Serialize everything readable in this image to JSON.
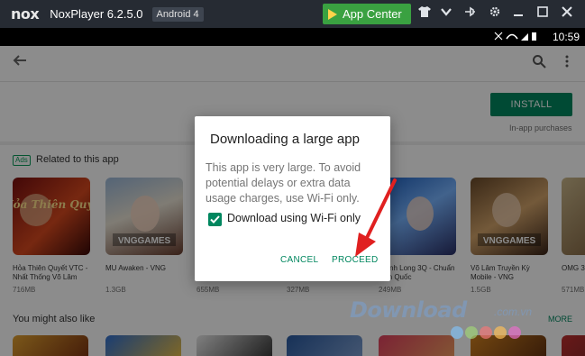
{
  "window": {
    "logo": "nox",
    "title": "NoxPlayer 6.2.5.0",
    "android_badge": "Android 4",
    "app_center_label": "App Center"
  },
  "statusbar": {
    "time": "10:59",
    "icons": "✱ ◥ ◢"
  },
  "store": {
    "install_label": "INSTALL",
    "in_app": "In-app purchases",
    "ads_badge": "Ads",
    "related_title": "Related to this app",
    "also_like_title": "You might also like",
    "more_label": "MORE",
    "apps": [
      {
        "name": "Hỏa Thiên Quyết VTC - Nhất Thống Võ Lâm",
        "size": "716MB"
      },
      {
        "name": "MU Awaken - VNG",
        "size": "1.3GB"
      },
      {
        "name": "",
        "size": "655MB"
      },
      {
        "name": "",
        "size": "327MB"
      },
      {
        "name": "Chinh Long 3Q - Chuẩn Tam Quốc",
        "size": "249MB"
      },
      {
        "name": "Võ Lâm Truyền Kỳ Mobile - VNG",
        "size": "1.5GB"
      },
      {
        "name": "OMG 3Q - Tam Quốc",
        "size": "571MB"
      }
    ],
    "thumb_texts": {
      "t1": "Hỏa Thiên Quyết",
      "t2": "VNGGAMES",
      "t6": "VNGGAMES"
    }
  },
  "dialog": {
    "title": "Downloading a large app",
    "message": "This app is very large. To avoid potential delays or extra data usage charges, use Wi-Fi only.",
    "checkbox_label": "Download using Wi-Fi only",
    "checkbox_checked": true,
    "cancel_label": "CANCEL",
    "proceed_label": "PROCEED"
  },
  "watermark": {
    "main": "Download",
    "sub": ".com.vn"
  },
  "colors": {
    "accent": "#01875f",
    "annotation": "#e02020",
    "app_center": "#3aa141"
  }
}
